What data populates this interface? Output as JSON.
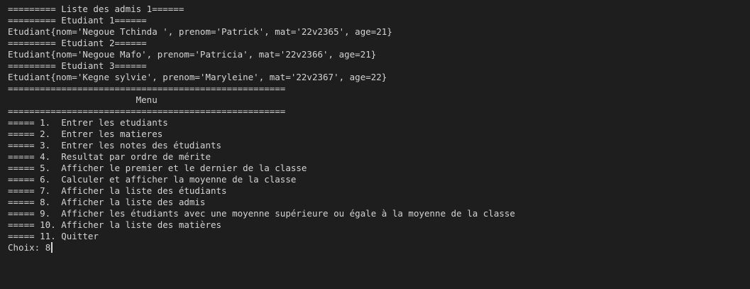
{
  "terminal": {
    "lines": [
      "========= Liste des admis 1======",
      "========= Etudiant 1======",
      "Etudiant{nom='Negoue Tchinda ', prenom='Patrick', mat='22v2365', age=21}",
      "========= Etudiant 2======",
      "Etudiant{nom='Negoue Mafo', prenom='Patricia', mat='22v2366', age=21}",
      "========= Etudiant 3======",
      "Etudiant{nom='Kegne sylvie', prenom='Maryleine', mat='22v2367', age=22}",
      "====================================================",
      "                        Menu",
      "====================================================",
      "===== 1.  Entrer les etudiants",
      "===== 2.  Entrer les matieres",
      "===== 3.  Entrer les notes des étudiants",
      "===== 4.  Resultat par ordre de mérite",
      "===== 5.  Afficher le premier et le dernier de la classe",
      "===== 6.  Calculer et afficher la moyenne de la classe",
      "===== 7.  Afficher la liste des étudiants",
      "===== 8.  Afficher la liste des admis",
      "===== 9.  Afficher les étudiants avec une moyenne supérieure ou égale à la moyenne de la classe",
      "===== 10. Afficher la liste des matières",
      "===== 11. Quitter"
    ],
    "prompt": "Choix: ",
    "input_value": "8"
  }
}
